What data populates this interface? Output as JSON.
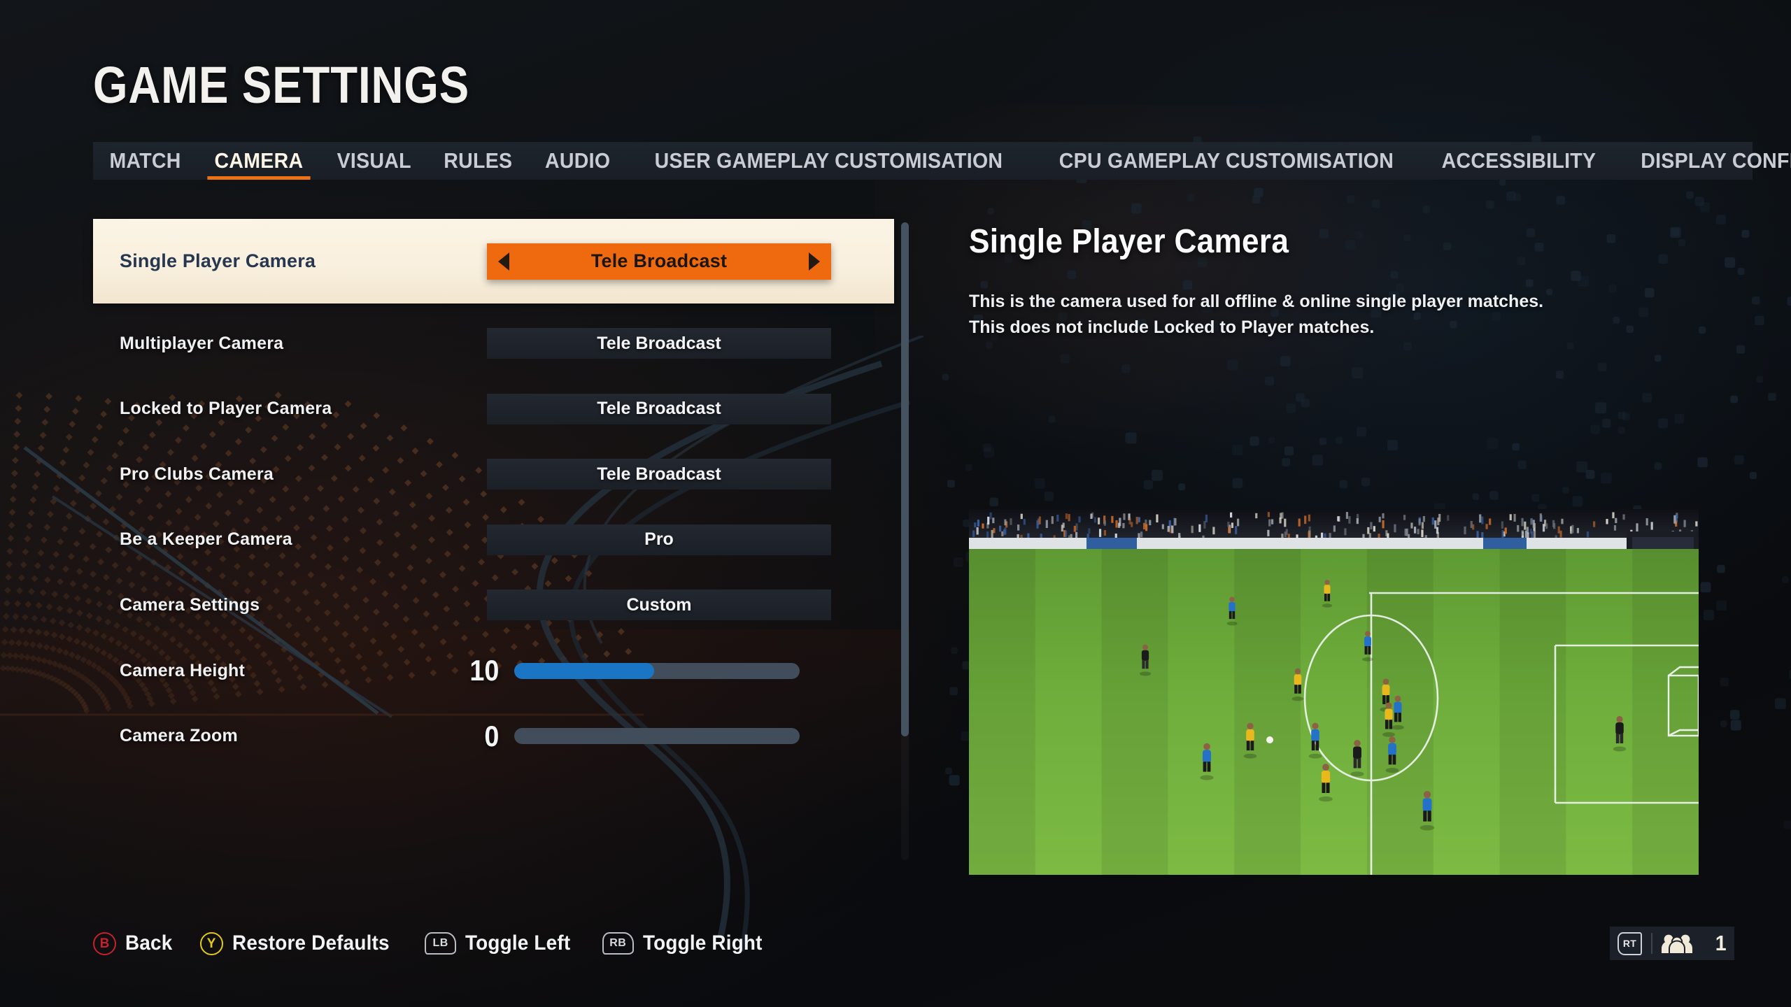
{
  "page": {
    "title": "GAME SETTINGS"
  },
  "tabs": [
    {
      "label": "MATCH",
      "active": false
    },
    {
      "label": "CAMERA",
      "active": true
    },
    {
      "label": "VISUAL",
      "active": false
    },
    {
      "label": "RULES",
      "active": false
    },
    {
      "label": "AUDIO",
      "active": false
    },
    {
      "label": "USER GAMEPLAY CUSTOMISATION",
      "active": false
    },
    {
      "label": "CPU GAMEPLAY CUSTOMISATION",
      "active": false
    },
    {
      "label": "ACCESSIBILITY",
      "active": false
    },
    {
      "label": "DISPLAY CONFIGURATION",
      "active": false
    }
  ],
  "settings": [
    {
      "label": "Single Player Camera",
      "value": "Tele Broadcast",
      "type": "stepper",
      "selected": true
    },
    {
      "label": "Multiplayer Camera",
      "value": "Tele Broadcast",
      "type": "option",
      "selected": false
    },
    {
      "label": "Locked to Player Camera",
      "value": "Tele Broadcast",
      "type": "option",
      "selected": false
    },
    {
      "label": "Pro Clubs Camera",
      "value": "Tele Broadcast",
      "type": "option",
      "selected": false
    },
    {
      "label": "Be a Keeper Camera",
      "value": "Pro",
      "type": "option",
      "selected": false
    },
    {
      "label": "Camera Settings",
      "value": "Custom",
      "type": "option",
      "selected": false
    },
    {
      "label": "Camera Height",
      "value": "10",
      "type": "slider",
      "fill_percent": 49,
      "selected": false
    },
    {
      "label": "Camera Zoom",
      "value": "0",
      "type": "slider",
      "fill_percent": 0,
      "selected": false
    }
  ],
  "detail": {
    "title": "Single Player Camera",
    "line1": "This is the camera used for all offline & online single player matches.",
    "line2": "This does not include Locked to Player matches."
  },
  "preview": {
    "alt": "football-match-preview"
  },
  "footer": {
    "hints": [
      {
        "button": "B",
        "label": "Back",
        "style": "circle-b"
      },
      {
        "button": "Y",
        "label": "Restore Defaults",
        "style": "circle-y"
      },
      {
        "button": "LB",
        "label": "Toggle Left",
        "style": "bumper"
      },
      {
        "button": "RB",
        "label": "Toggle Right",
        "style": "bumper"
      }
    ],
    "status": {
      "trigger": "RT",
      "player_count": "1"
    }
  },
  "colors": {
    "accent_orange": "#ef6a0e",
    "tab_underline": "#ef7116",
    "selected_row_bg": "#faf1e2",
    "selected_row_text": "#27374f",
    "slider_fill": "#1a76c4",
    "slider_track": "#414d5a",
    "b_button": "#c8202c",
    "y_button": "#e2cb12"
  }
}
